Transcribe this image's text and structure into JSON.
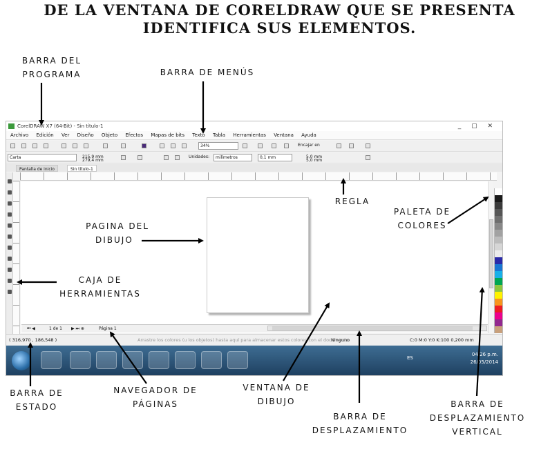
{
  "heading": {
    "line1": "De la ventana de CorelDraw que se presenta",
    "line2": "identifica sus elementos."
  },
  "labels": {
    "barra_programa": [
      "BARRA DEL",
      "PROGRAMA"
    ],
    "barra_menus": "BARRA DE MENÚS",
    "regla": "REGLA",
    "paleta": [
      "PALETA DE",
      "COLORES"
    ],
    "pagina": [
      "PAGINA DEL",
      "DIBUJO"
    ],
    "caja": [
      "CAJA DE",
      "HERRAMIENTAS"
    ],
    "barra_estado": [
      "BARRA DE",
      "ESTADO"
    ],
    "navegador": [
      "NAVEGADOR DE",
      "PÁGINAS"
    ],
    "ventana": [
      "VENTANA DE",
      "DIBUJO"
    ],
    "desplazamiento": [
      "BARRA DE",
      "DESPLAZAMIENTO"
    ],
    "desplazamiento_vertical": [
      "BARRA DE",
      "DESPLAZAMIENTO",
      "VERTICAL"
    ]
  },
  "screenshot": {
    "window_title": "CorelDRAW X7 (64-Bit) - Sin título-1",
    "window_buttons": "_ ▢ ✕",
    "menu": [
      "Archivo",
      "Edición",
      "Ver",
      "Diseño",
      "Objeto",
      "Efectos",
      "Mapas de bits",
      "Texto",
      "Tabla",
      "Herramientas",
      "Ventana",
      "Ayuda"
    ],
    "zoom": "34%",
    "snap": "Encajar en",
    "page_size": "Carta",
    "width": "215,9 mm",
    "height": "279,4 mm",
    "units_label": "Unidades:",
    "units": "milímetros",
    "nudge": "0,1 mm",
    "dup1": "5,0 mm",
    "dup2": "5,0 mm",
    "tabs": [
      "Pantalla de inicio",
      "Sin título-1"
    ],
    "page_nav": "1 de 1",
    "page_tab": "Página 1",
    "hint": "Arrastre los colores (u los objetos) hasta aquí para almacenar estos colores con el documento",
    "coords": "( 316,970 , 186,548 )",
    "fill_none": "Ninguno",
    "color_info": "C:0 M:0 Y:0 K:100 0,200 mm",
    "lang": "ES",
    "time": "04:26 p.m.",
    "date": "26/05/2014",
    "palette_colors": [
      "#ffffff",
      "#1a1a1a",
      "#3a3a3a",
      "#555555",
      "#6e6e6e",
      "#888888",
      "#a2a2a2",
      "#bcbcbc",
      "#d6d6d6",
      "#ececec",
      "#2a2aa8",
      "#1976d2",
      "#18b0e8",
      "#00a651",
      "#8dc63f",
      "#fff200",
      "#f7941d",
      "#ed1c24",
      "#ec008c",
      "#92278f",
      "#c8a07c"
    ]
  }
}
